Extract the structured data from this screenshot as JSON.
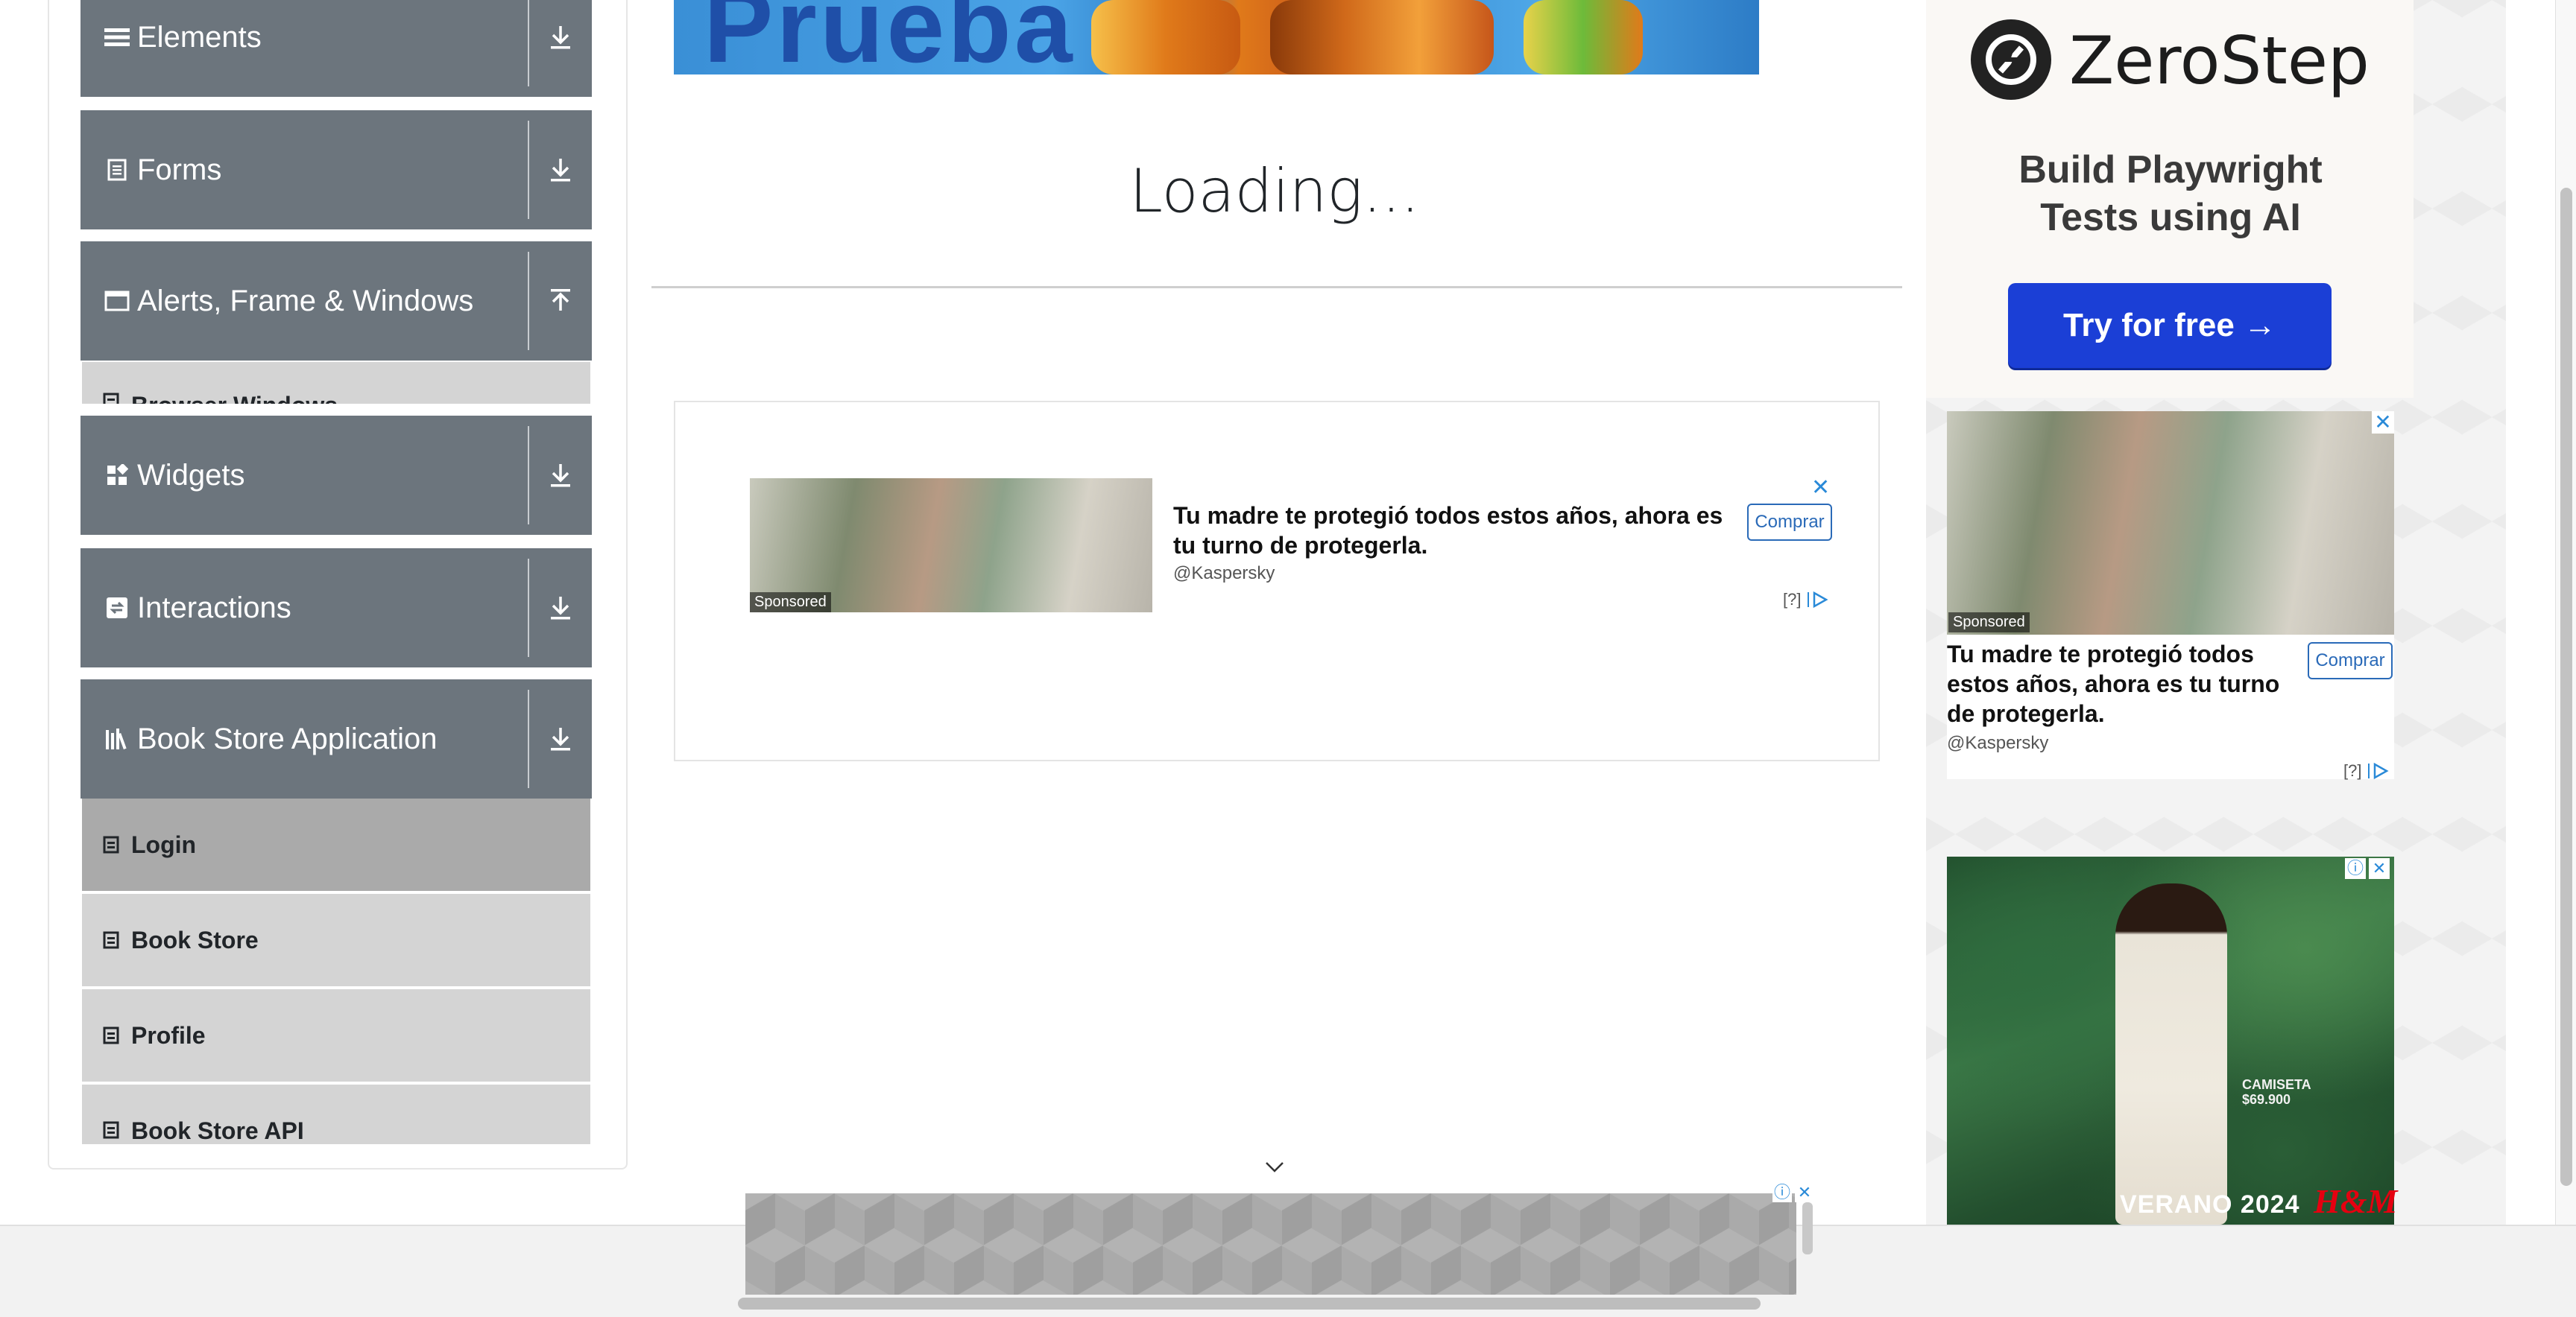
{
  "sidebar": {
    "groups": [
      {
        "label": "Elements",
        "icon": "hamburger-icon",
        "toggle": "down-arrow-icon"
      },
      {
        "label": "Forms",
        "icon": "document-icon",
        "toggle": "down-arrow-icon"
      },
      {
        "label": "Alerts, Frame & Windows",
        "icon": "window-icon",
        "toggle": "up-arrow-icon"
      },
      {
        "label": "Widgets",
        "icon": "widgets-icon",
        "toggle": "down-arrow-icon"
      },
      {
        "label": "Interactions",
        "icon": "interactions-icon",
        "toggle": "down-arrow-icon"
      },
      {
        "label": "Book Store Application",
        "icon": "books-icon",
        "toggle": "down-arrow-icon"
      }
    ],
    "alerts_partial_item": "Browser Windows",
    "bookstore_items": [
      {
        "label": "Login",
        "active": true
      },
      {
        "label": "Book Store",
        "active": false
      },
      {
        "label": "Profile",
        "active": false
      },
      {
        "label": "Book Store API",
        "active": false
      }
    ]
  },
  "main": {
    "top_banner_text": "Prueba",
    "loading_text": "Loading...",
    "ad": {
      "sponsored": "Sponsored",
      "headline": "Tu madre te protegió todos estos años, ahora es tu turno de protegerla.",
      "source": "@Kaspersky",
      "cta": "Comprar",
      "info": "[?]"
    }
  },
  "right_ads": {
    "zerostep": {
      "brand": "ZeroStep",
      "tagline_line1": "Build Playwright",
      "tagline_line2": "Tests using AI",
      "cta": "Try for free →"
    },
    "kaspersky": {
      "sponsored": "Sponsored",
      "headline": "Tu madre te protegió todos estos años, ahora es tu turno de protegerla.",
      "source": "@Kaspersky",
      "cta": "Comprar",
      "info": "[?]"
    },
    "hm": {
      "price_line1": "CAMISETA",
      "price_line2": "$69.900",
      "campaign": "VERANO 2024",
      "logo": "H&M"
    }
  },
  "colors": {
    "sidebar_header_bg": "#6c757d",
    "menu_item_bg": "#d4d4d4",
    "menu_item_active_bg": "#aaaaaa",
    "zerostep_cta_bg": "#1b3fd6",
    "ad_accent": "#2a6ab8",
    "hm_red": "#e50010"
  }
}
